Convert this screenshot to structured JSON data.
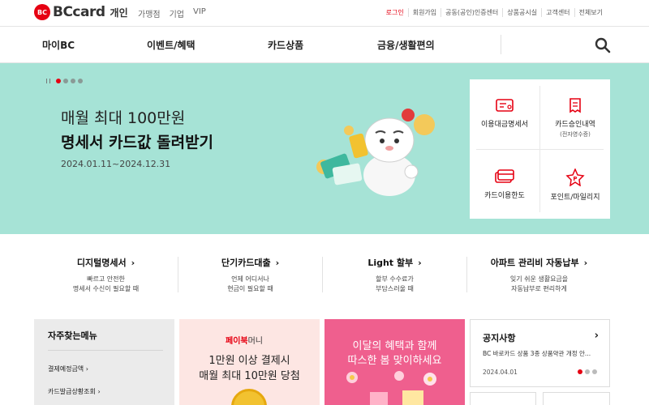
{
  "header": {
    "logo_mark": "BC",
    "logo_text": "BCcard",
    "logo_sub": "개인",
    "left_links": [
      "가맹점",
      "기업",
      "VIP"
    ],
    "right_links": [
      "로그인",
      "회원가입",
      "공동(공인)인증센터",
      "상품공시실",
      "고객센터",
      "전체보기"
    ]
  },
  "nav": {
    "items": [
      "마이BC",
      "이벤트/혜택",
      "카드상품",
      "금융/생활편의"
    ]
  },
  "hero": {
    "line1": "매월 최대 100만원",
    "line2": "명세서 카드값 돌려받기",
    "date": "2024.01.11~2024.12.31",
    "slide_count": 4,
    "active_slide": 1
  },
  "quick_menu": [
    {
      "label": "이용대금명세서",
      "sub": "",
      "icon": "statement-icon"
    },
    {
      "label": "카드승인내역",
      "sub": "(전자영수증)",
      "icon": "receipt-icon"
    },
    {
      "label": "카드이용한도",
      "sub": "",
      "icon": "card-limit-icon"
    },
    {
      "label": "포인트/마일리지",
      "sub": "",
      "icon": "point-icon"
    }
  ],
  "services": [
    {
      "title": "디지털명세서",
      "desc1": "빠르고 안전한",
      "desc2": "명세서 수신이 필요할 때"
    },
    {
      "title": "단기카드대출",
      "desc1": "언제 어디서나",
      "desc2": "현금이 필요할 때"
    },
    {
      "title": "Light 할부",
      "desc1": "할부 수수료가",
      "desc2": "부담스러울 때"
    },
    {
      "title": "아파트 관리비 자동납부",
      "desc1": "잊기 쉬운 생활요금을",
      "desc2": "자동납부로 편리하게"
    }
  ],
  "favorites": {
    "title": "자주찾는메뉴",
    "items": [
      "결제예정금액",
      "카드발급상황조회"
    ]
  },
  "promo1": {
    "brand": "페이북",
    "brand2": "머니",
    "line1": "1만원 이상 결제시",
    "line2": "매월 최대 10만원 당첨"
  },
  "promo2": {
    "line1": "이달의 혜택과 함께",
    "line2": "따스한 봄 맞이하세요"
  },
  "notice": {
    "title": "공지사항",
    "text": "BC 바로카드 상품 3종 상품약관 개정 안...",
    "date": "2024.04.01"
  },
  "colors": {
    "brand_red": "#e60012",
    "hero_bg": "#a6e3d6",
    "promo1_bg": "#fde6e3",
    "promo2_bg": "#ef5f8e"
  }
}
